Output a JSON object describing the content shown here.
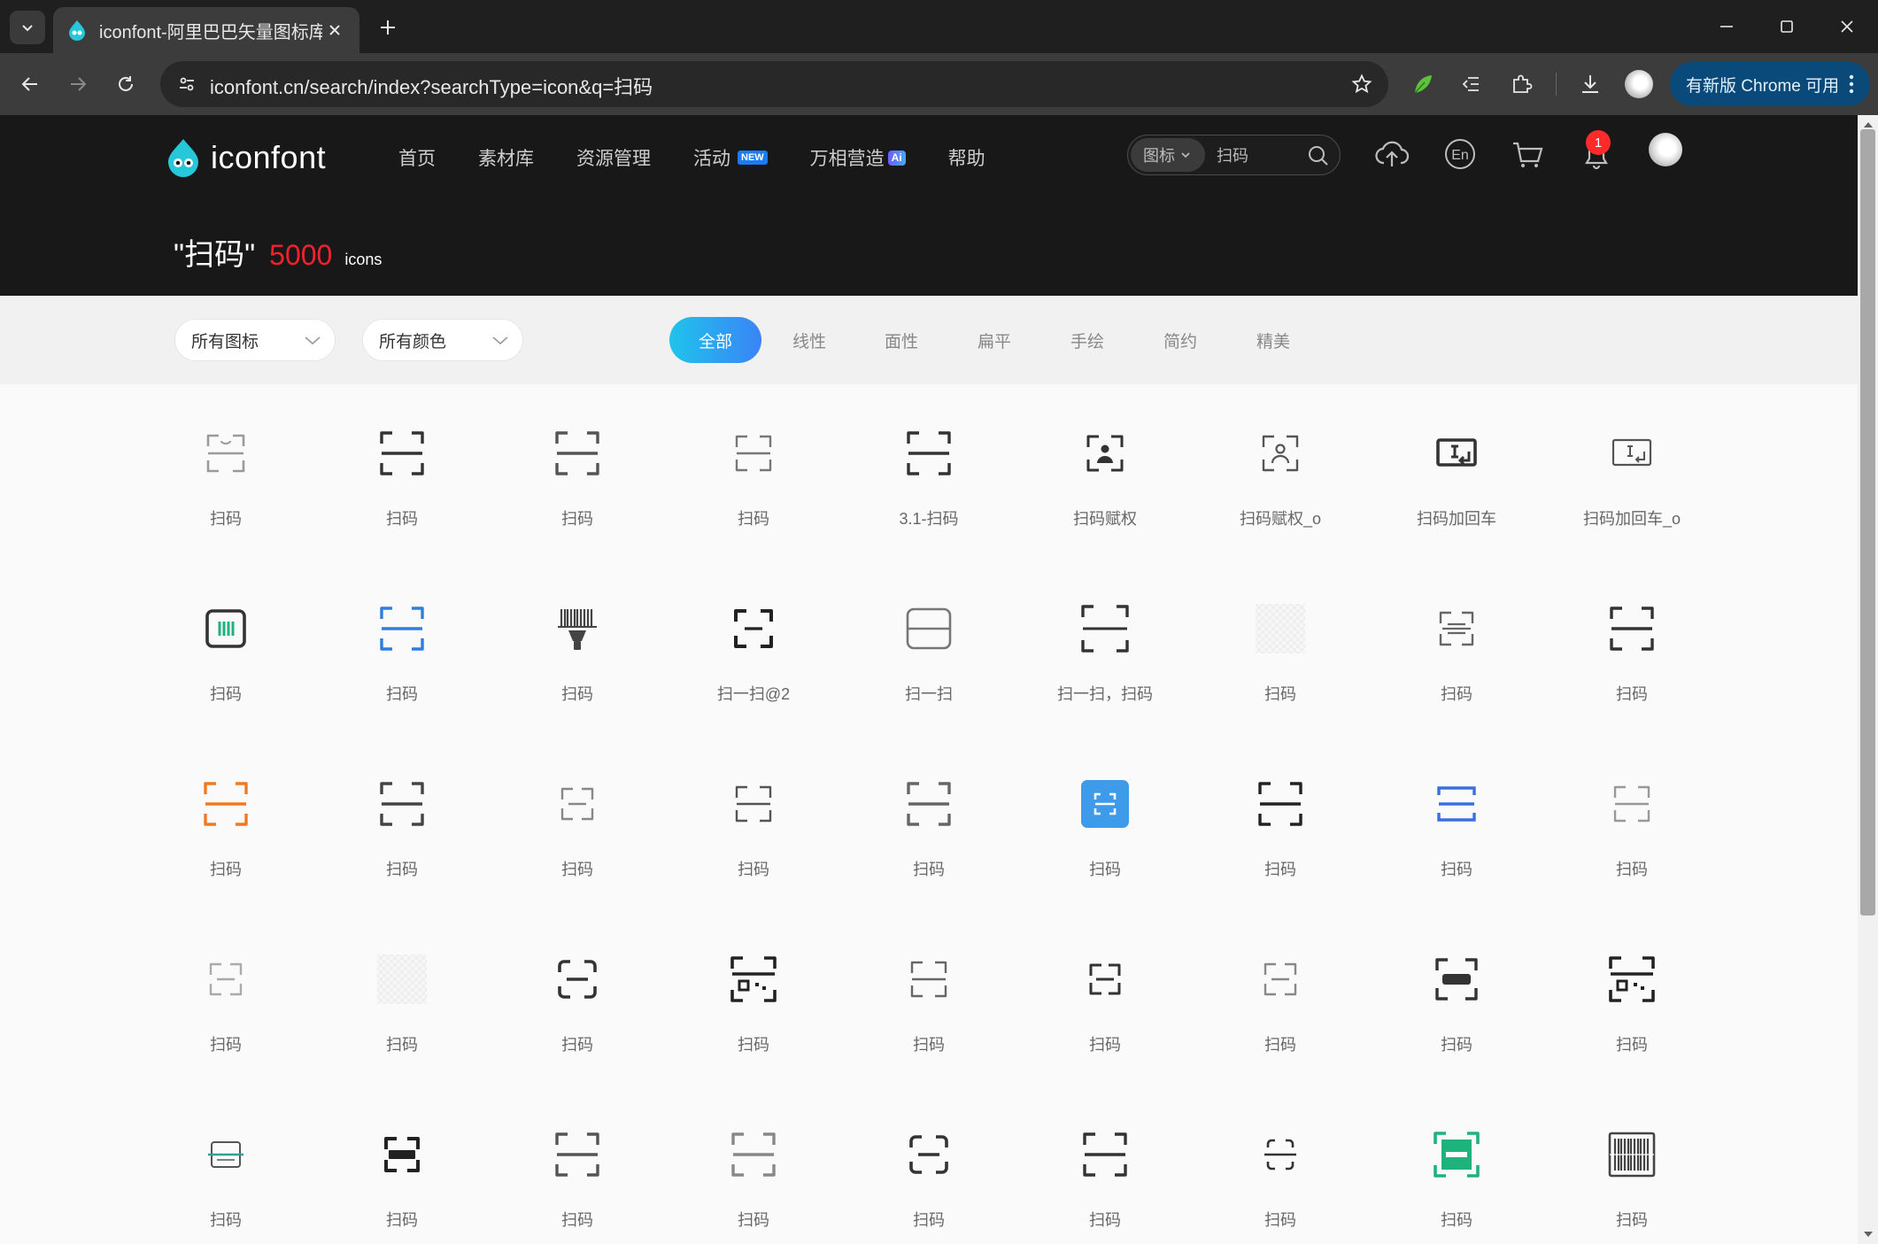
{
  "browser": {
    "tab_title": "iconfont-阿里巴巴矢量图标库",
    "url": "iconfont.cn/search/index?searchType=icon&q=扫码",
    "update_label": "有新版 Chrome 可用"
  },
  "site": {
    "logo_text": "iconfont",
    "nav": [
      {
        "label": "首页"
      },
      {
        "label": "素材库"
      },
      {
        "label": "资源管理"
      },
      {
        "label": "活动",
        "badge": "NEW"
      },
      {
        "label": "万相营造",
        "badge": "Ai"
      },
      {
        "label": "帮助"
      }
    ],
    "search": {
      "type_label": "图标",
      "query": "扫码"
    },
    "notification_count": "1",
    "lang_icon_text": "En"
  },
  "results": {
    "query_display": "\"扫码\"",
    "count": "5000",
    "unit": "icons"
  },
  "filters": {
    "dropdowns": [
      "所有图标",
      "所有颜色"
    ],
    "style_tabs": [
      "全部",
      "线性",
      "面性",
      "扁平",
      "手绘",
      "简约",
      "精美"
    ],
    "active_tab": "全部"
  },
  "icons": [
    {
      "label": "扫码",
      "icon": "scan-bracket-smile-icon",
      "color": "#9a9a9a"
    },
    {
      "label": "扫码",
      "icon": "scan-bracket-icon",
      "color": "#333333"
    },
    {
      "label": "扫码",
      "icon": "scan-bracket-icon",
      "color": "#555555"
    },
    {
      "label": "扫码",
      "icon": "scan-bracket-thin-icon",
      "color": "#777777"
    },
    {
      "label": "3.1-扫码",
      "icon": "scan-bracket-icon",
      "color": "#333333"
    },
    {
      "label": "扫码赋权",
      "icon": "scan-person-icon",
      "color": "#333333"
    },
    {
      "label": "扫码赋权_o",
      "icon": "scan-person-outline-icon",
      "color": "#555555"
    },
    {
      "label": "扫码加回车",
      "icon": "scan-enter-icon",
      "color": "#333333"
    },
    {
      "label": "扫码加回车_o",
      "icon": "scan-enter-outline-icon",
      "color": "#555555"
    },
    {
      "label": "扫码",
      "icon": "scan-barcode-frame-icon",
      "color": "#333333",
      "accent": "#1fb27d"
    },
    {
      "label": "扫码",
      "icon": "scan-bracket-icon",
      "color": "#2f7de1"
    },
    {
      "label": "扫码",
      "icon": "barcode-scanner-gun-icon",
      "color": "#444444"
    },
    {
      "label": "扫一扫@2",
      "icon": "scan-corners-icon",
      "color": "#222222"
    },
    {
      "label": "扫一扫",
      "icon": "scan-rounded-box-icon",
      "color": "#777777"
    },
    {
      "label": "扫一扫，扫码",
      "icon": "scan-corners-line-icon",
      "color": "#333333"
    },
    {
      "label": "扫码",
      "icon": "placeholder-checker-icon",
      "color": "#dddddd"
    },
    {
      "label": "扫码",
      "icon": "scan-lines-icon",
      "color": "#666666"
    },
    {
      "label": "扫码",
      "icon": "scan-bracket-icon",
      "color": "#333333"
    },
    {
      "label": "扫码",
      "icon": "scan-bracket-icon",
      "color": "#f07a22"
    },
    {
      "label": "扫码",
      "icon": "scan-bracket-icon",
      "color": "#444444"
    },
    {
      "label": "扫码",
      "icon": "scan-dashed-icon",
      "color": "#888888"
    },
    {
      "label": "扫码",
      "icon": "scan-bracket-thin-icon",
      "color": "#555555"
    },
    {
      "label": "扫码",
      "icon": "scan-bracket-icon",
      "color": "#666666"
    },
    {
      "label": "扫码",
      "icon": "scan-filled-square-icon",
      "color": "#3d9be9"
    },
    {
      "label": "扫码",
      "icon": "scan-bracket-icon",
      "color": "#222222"
    },
    {
      "label": "扫码",
      "icon": "scan-box-line-icon",
      "color": "#3b6fe0"
    },
    {
      "label": "扫码",
      "icon": "scan-bracket-thin-icon",
      "color": "#999999"
    },
    {
      "label": "扫码",
      "icon": "scan-dashed-icon",
      "color": "#aaaaaa"
    },
    {
      "label": "扫码",
      "icon": "placeholder-checker-icon",
      "color": "#dddddd"
    },
    {
      "label": "扫码",
      "icon": "scan-round-corners-icon",
      "color": "#333333"
    },
    {
      "label": "扫码",
      "icon": "scan-qr-icon",
      "color": "#222222"
    },
    {
      "label": "扫码",
      "icon": "scan-bracket-thin-icon",
      "color": "#666666"
    },
    {
      "label": "扫码",
      "icon": "scan-small-corners-icon",
      "color": "#333333"
    },
    {
      "label": "扫码",
      "icon": "scan-dashed-icon",
      "color": "#888888"
    },
    {
      "label": "扫码",
      "icon": "scan-bar-icon",
      "color": "#333333"
    },
    {
      "label": "扫码",
      "icon": "scan-qr-icon",
      "color": "#222222"
    },
    {
      "label": "扫码",
      "icon": "scan-teal-line-icon",
      "color": "#555555",
      "accent": "#27a39a"
    },
    {
      "label": "扫码",
      "icon": "scan-bar-bold-icon",
      "color": "#222222"
    },
    {
      "label": "扫码",
      "icon": "scan-bracket-icon",
      "color": "#555555"
    },
    {
      "label": "扫码",
      "icon": "scan-bracket-icon",
      "color": "#888888"
    },
    {
      "label": "扫码",
      "icon": "scan-round-corners-icon",
      "color": "#333333"
    },
    {
      "label": "扫码",
      "icon": "scan-bracket-icon",
      "color": "#333333"
    },
    {
      "label": "扫码",
      "icon": "scan-eye-icon",
      "color": "#333333"
    },
    {
      "label": "扫码",
      "icon": "scan-green-bar-icon",
      "color": "#1fb27d"
    },
    {
      "label": "扫码",
      "icon": "barcode-box-icon",
      "color": "#444444"
    }
  ]
}
